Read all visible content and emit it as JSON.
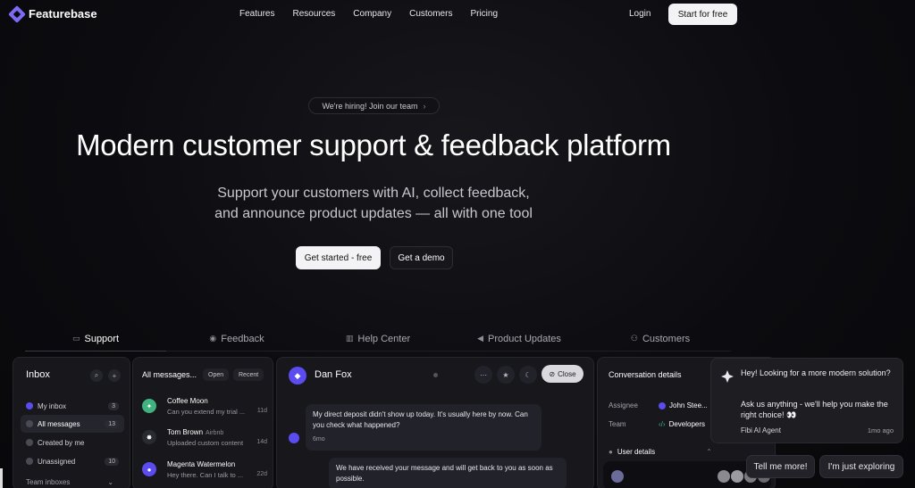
{
  "brand": {
    "name": "Featurebase",
    "accent": "#7c6cf2"
  },
  "nav": {
    "items": [
      "Features",
      "Resources",
      "Company",
      "Customers",
      "Pricing"
    ],
    "login": "Login",
    "start": "Start for free"
  },
  "hero": {
    "badge": "We're hiring! Join our team",
    "badge_arrow": "›",
    "title": "Modern customer support & feedback platform",
    "subtitle_line1": "Support your customers with AI, collect feedback,",
    "subtitle_line2": "and announce product updates — all with one tool",
    "cta_primary": "Get started - free",
    "cta_secondary": "Get a demo"
  },
  "tabs": [
    {
      "label": "Support",
      "icon": "inbox-icon",
      "active": true
    },
    {
      "label": "Feedback",
      "icon": "bulb-icon",
      "active": false
    },
    {
      "label": "Help Center",
      "icon": "book-icon",
      "active": false
    },
    {
      "label": "Product Updates",
      "icon": "megaphone-icon",
      "active": false
    },
    {
      "label": "Customers",
      "icon": "users-icon",
      "active": false
    }
  ],
  "inbox": {
    "title": "Inbox",
    "items": [
      {
        "label": "My inbox",
        "count": "3"
      },
      {
        "label": "All messages",
        "count": "13"
      },
      {
        "label": "Created by me",
        "count": ""
      },
      {
        "label": "Unassigned",
        "count": "10"
      }
    ],
    "team_inboxes": "Team inboxes"
  },
  "messages": {
    "header": "All messages...",
    "filter_open": "Open",
    "filter_recent": "Recent",
    "items": [
      {
        "name": "Coffee Moon",
        "company": "",
        "preview": "Can you extend my trial ...",
        "time": "11d",
        "color": "#3fb27f"
      },
      {
        "name": "Tom Brown",
        "company": "Airbnb",
        "preview": "Uploaded custom content",
        "time": "14d",
        "color": "#2a2a32"
      },
      {
        "name": "Magenta Watermelon",
        "company": "",
        "preview": "Hey there. Can I talk to ...",
        "time": "22d",
        "color": "#5b4cf0"
      }
    ]
  },
  "conversation": {
    "name": "Dan Fox",
    "close": "Close",
    "message_in": "My direct deposit didn't show up today. It's usually here by now. Can you check what happened?",
    "message_in_time": "6mo",
    "message_out": "We have received your message and will get back to you as soon as possible."
  },
  "details": {
    "title": "Conversation details",
    "assignee_label": "Assignee",
    "assignee_value": "John Stee...",
    "team_label": "Team",
    "team_value": "Developers",
    "user_details": "User details"
  },
  "chat": {
    "line1": "Hey! Looking for a more modern solution?",
    "line2": "Ask us anything - we'll help you make the right choice! 👀",
    "agent": "Fibi AI Agent",
    "time": "1mo ago",
    "reply1": "Tell me more!",
    "reply2": "I'm just exploring"
  }
}
